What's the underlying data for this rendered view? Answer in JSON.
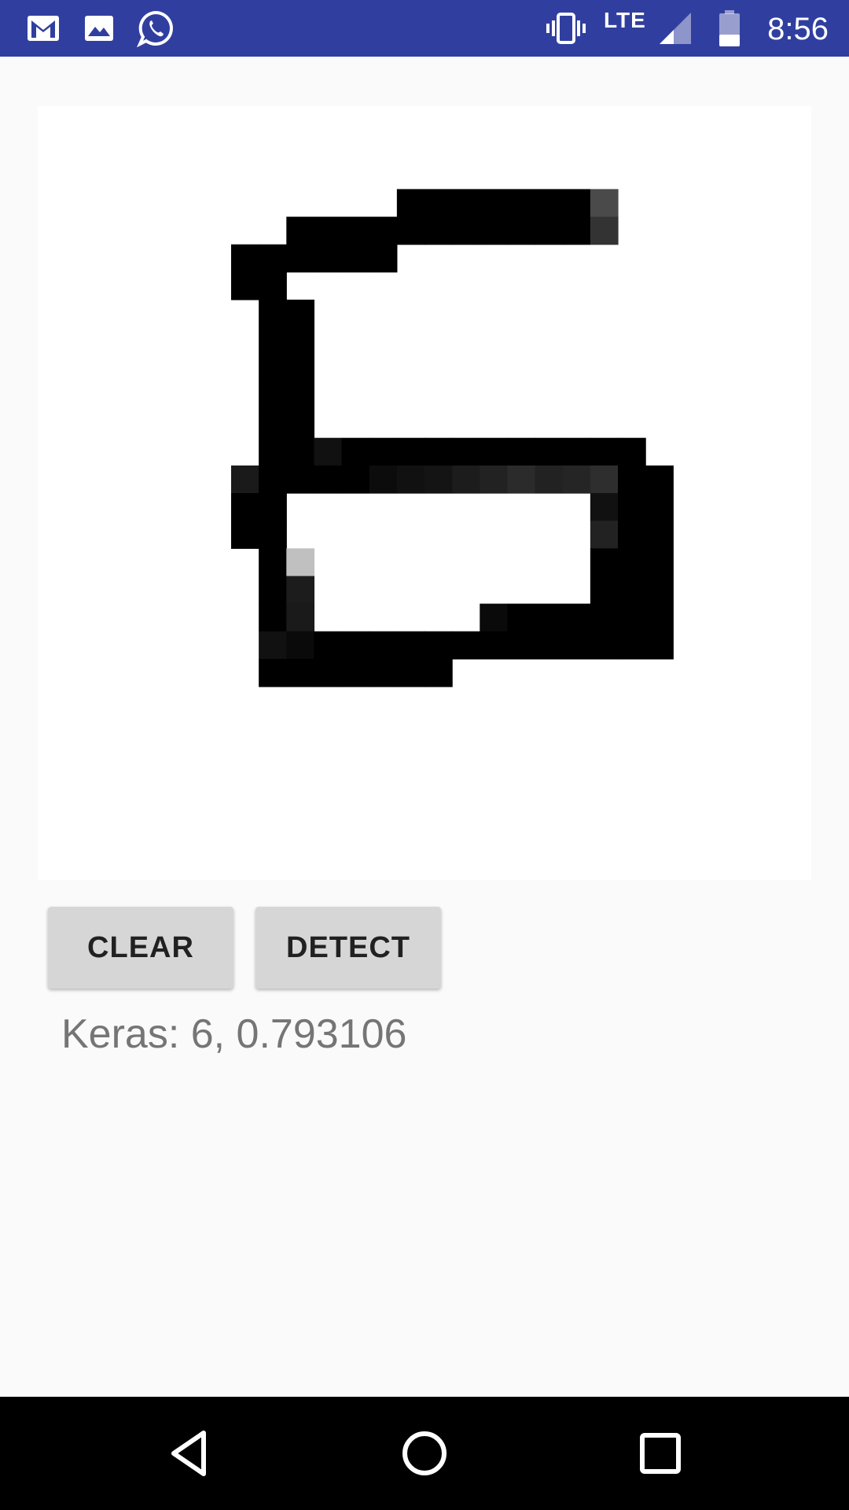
{
  "status_bar": {
    "time": "8:56",
    "network_label": "LTE",
    "icons": [
      "gmail-icon",
      "gallery-icon",
      "whatsapp-icon",
      "vibrate-icon",
      "signal-icon",
      "battery-icon"
    ],
    "color": "#303f9f"
  },
  "canvas": {
    "drawn_digit": "6"
  },
  "buttons": {
    "clear_label": "CLEAR",
    "detect_label": "DETECT"
  },
  "result": {
    "text": "Keras: 6, 0.793106"
  },
  "nav_bar": {
    "icons": [
      "back-icon",
      "home-icon",
      "recents-icon"
    ]
  }
}
